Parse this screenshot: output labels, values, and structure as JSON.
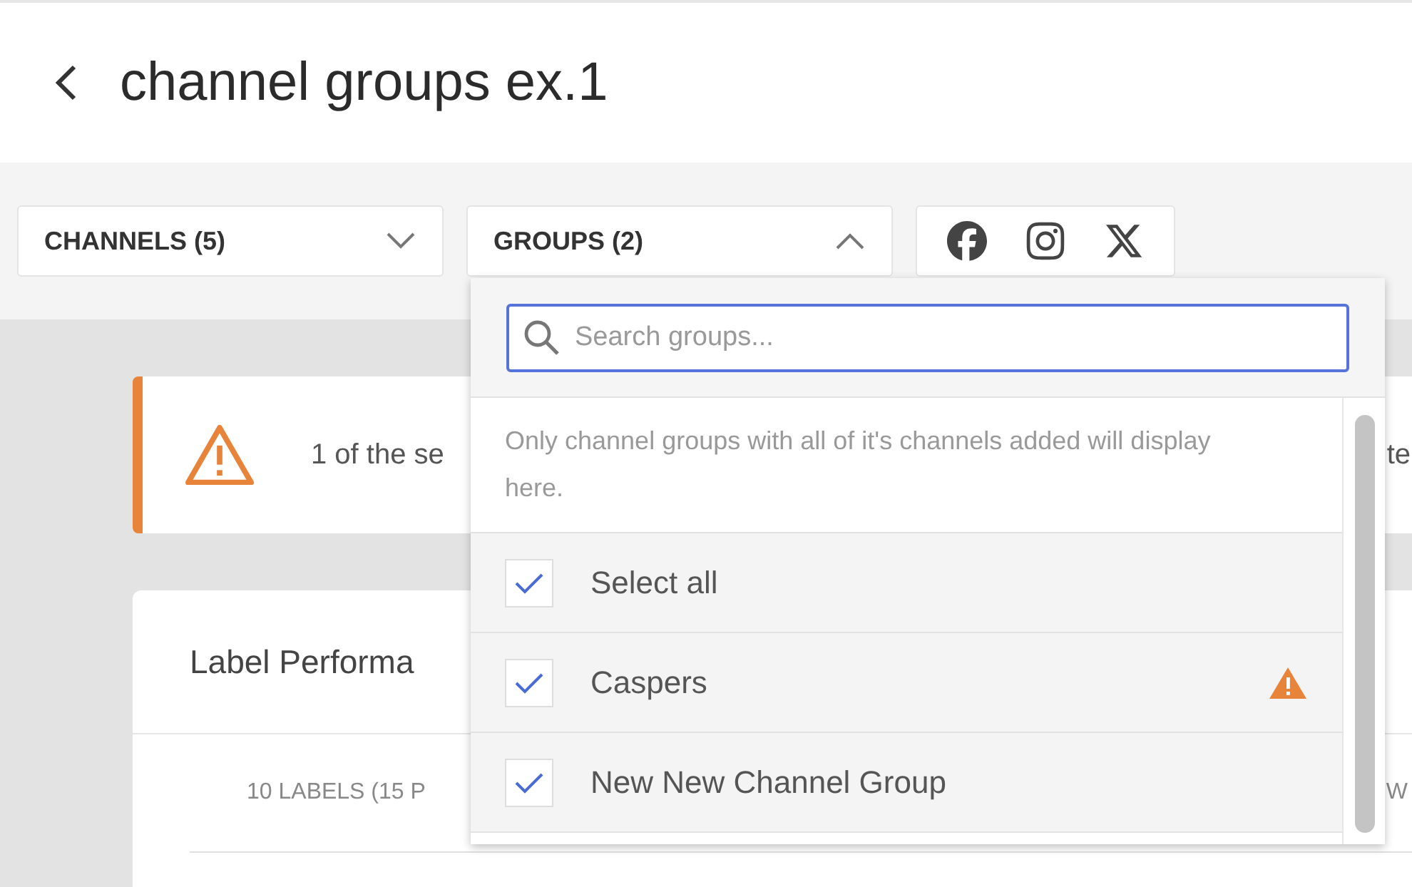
{
  "page": {
    "title": "channel groups ex.1"
  },
  "filters": [
    {
      "label": "CHANNELS (5)",
      "expanded": false
    },
    {
      "label": "GROUPS (2)",
      "expanded": true
    }
  ],
  "alert": {
    "text_start": "1 of the se",
    "text_end": "te"
  },
  "card": {
    "title": "Label Performa",
    "summary": "10 LABELS (15 P",
    "column_end": "W"
  },
  "dropdown": {
    "search": {
      "placeholder": "Search groups..."
    },
    "note": "Only channel groups with all of it's channels added will display here.",
    "options": [
      {
        "label": "Select all",
        "checked": true,
        "warning": false
      },
      {
        "label": "Caspers",
        "checked": true,
        "warning": true
      },
      {
        "label": "New New Channel Group",
        "checked": true,
        "warning": false
      }
    ]
  }
}
